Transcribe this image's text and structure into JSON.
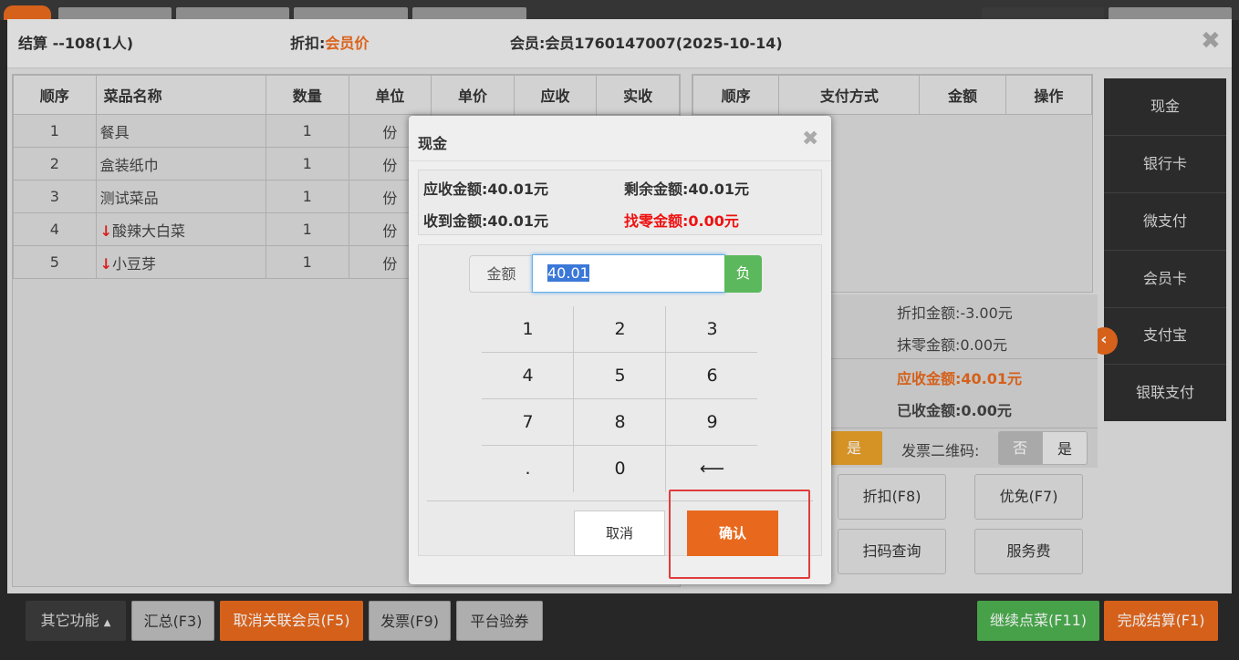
{
  "window": {
    "title": "结算 --108(1人)",
    "discount_label": "折扣:",
    "discount_value": "会员价",
    "member_label": "会员:",
    "member_value": "会员1760147007(2025-10-14)",
    "close": "✖"
  },
  "items_table": {
    "headers": [
      "顺序",
      "菜品名称",
      "数量",
      "单位",
      "单价",
      "应收",
      "实收"
    ],
    "rows": [
      {
        "seq": "1",
        "arrow": "",
        "name": "餐具",
        "qty": "1",
        "unit": "份"
      },
      {
        "seq": "2",
        "arrow": "",
        "name": "盒装纸巾",
        "qty": "1",
        "unit": "份"
      },
      {
        "seq": "3",
        "arrow": "",
        "name": "测试菜品",
        "qty": "1",
        "unit": "份"
      },
      {
        "seq": "4",
        "arrow": "↓",
        "name": "酸辣大白菜",
        "qty": "1",
        "unit": "份"
      },
      {
        "seq": "5",
        "arrow": "↓",
        "name": "小豆芽",
        "qty": "1",
        "unit": "份"
      }
    ]
  },
  "payments_table": {
    "headers": [
      "顺序",
      "支付方式",
      "金额",
      "操作"
    ]
  },
  "pay_methods": [
    "现金",
    "银行卡",
    "微支付",
    "会员卡",
    "支付宝",
    "银联支付"
  ],
  "summary": {
    "discount_amount": "折扣金额:-3.00元",
    "rounding_amount": "抹零金额:0.00元",
    "receivable": "应收金额:40.01元",
    "received": "已收金额:0.00元",
    "yes_btn": "是",
    "invoice_qr_label": "发票二维码:",
    "invoice_no": "否",
    "invoice_yes": "是",
    "btn_discount": "折扣(F8)",
    "btn_coupon": "优免(F7)",
    "btn_scan": "扫码查询",
    "btn_service": "服务费"
  },
  "bottom_bar": {
    "other": "其它功能",
    "other_icon": "▲",
    "summary": "汇总(F3)",
    "cancel_member": "取消关联会员(F5)",
    "invoice": "发票(F9)",
    "platform": "平台验券",
    "continue_order": "继续点菜(F11)",
    "finish": "完成结算(F1)"
  },
  "modal": {
    "title": "现金",
    "close": "✖",
    "receivable": "应收金额:40.01元",
    "remaining": "剩余金额:40.01元",
    "received": "收到金额:40.01元",
    "change": "找零金额:0.00元",
    "amount_label": "金额",
    "amount_value": "40.01",
    "negative_btn": "负",
    "keys": [
      "1",
      "2",
      "3",
      "4",
      "5",
      "6",
      "7",
      "8",
      "9",
      ".",
      "0",
      "⟵"
    ],
    "cancel": "取消",
    "confirm": "确认"
  },
  "colors": {
    "accent_orange": "#e8691d",
    "green": "#4caf50",
    "highlight_red": "#e23b3b"
  }
}
